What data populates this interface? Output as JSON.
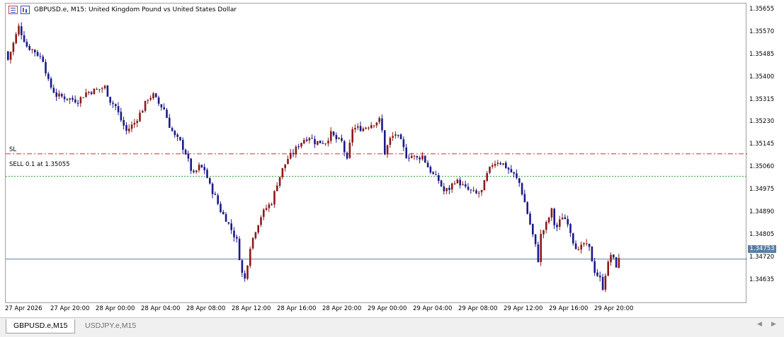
{
  "window": {
    "title": "GBPUSD.e, M15:  United Kingdom Pound vs United States Dollar"
  },
  "icons": {
    "title_left": "order-list-icon",
    "title_right": "candle-chart-icon"
  },
  "price_axis": {
    "labels": [
      "1.35655",
      "1.35570",
      "1.35485",
      "1.35400",
      "1.35315",
      "1.35230",
      "1.35145",
      "1.35060",
      "1.34975",
      "1.34890",
      "1.34805",
      "1.34720",
      "1.34635"
    ],
    "current_price": "1.34753"
  },
  "time_axis": {
    "labels": [
      "27 Apr 2026",
      "27 Apr 20:00",
      "28 Apr 00:00",
      "28 Apr 04:00",
      "28 Apr 08:00",
      "28 Apr 12:00",
      "28 Apr 16:00",
      "28 Apr 20:00",
      "29 Apr 00:00",
      "29 Apr 04:00",
      "29 Apr 08:00",
      "29 Apr 12:00",
      "29 Apr 16:00",
      "29 Apr 20:00"
    ]
  },
  "trade_lines": {
    "sl_label": "SL",
    "sell_label": "SELL 0.1 at 1.35055",
    "sl_price": 1.35137,
    "sell_price": 1.35055,
    "sl_color": "#d03030",
    "sell_color": "#3aa03a",
    "bid_color": "#5c7fa0"
  },
  "colors": {
    "bull": "#8b1a1a",
    "bear": "#1a1a8b",
    "background": "#ffffff"
  },
  "tabs": [
    {
      "label": "GBPUSD.e,M15",
      "active": true
    },
    {
      "label": "USDJPY.e,M15",
      "active": false
    }
  ],
  "chart_data": {
    "type": "candlestick",
    "symbol": "GBPUSD.e",
    "timeframe": "M15",
    "ylim": [
      1.3459,
      1.35685
    ],
    "close_path": [
      [
        0,
        1.3548
      ],
      [
        4,
        1.356
      ],
      [
        7,
        1.3553
      ],
      [
        10,
        1.3551
      ],
      [
        13,
        1.3548
      ],
      [
        15,
        1.354
      ],
      [
        16,
        1.3538
      ],
      [
        18,
        1.3535
      ],
      [
        22,
        1.3534
      ],
      [
        26,
        1.3533
      ],
      [
        29,
        1.3536
      ],
      [
        33,
        1.3537
      ],
      [
        36,
        1.3538
      ],
      [
        38,
        1.3533
      ],
      [
        40,
        1.3531
      ],
      [
        42,
        1.3526
      ],
      [
        44,
        1.3522
      ],
      [
        47,
        1.3525
      ],
      [
        50,
        1.353
      ],
      [
        52,
        1.3534
      ],
      [
        54,
        1.3535
      ],
      [
        56,
        1.3532
      ],
      [
        58,
        1.353
      ],
      [
        60,
        1.3524
      ],
      [
        62,
        1.352
      ],
      [
        64,
        1.3518
      ],
      [
        66,
        1.3514
      ],
      [
        68,
        1.3508
      ],
      [
        69,
        1.3506
      ],
      [
        71,
        1.3509
      ],
      [
        73,
        1.3508
      ],
      [
        75,
        1.3502
      ],
      [
        77,
        1.3498
      ],
      [
        79,
        1.3493
      ],
      [
        81,
        1.349
      ],
      [
        83,
        1.3486
      ],
      [
        85,
        1.3482
      ],
      [
        86,
        1.3476
      ],
      [
        87,
        1.347
      ],
      [
        88,
        1.3468
      ],
      [
        89,
        1.3474
      ],
      [
        90,
        1.348
      ],
      [
        92,
        1.3486
      ],
      [
        94,
        1.3491
      ],
      [
        96,
        1.3494
      ],
      [
        98,
        1.3496
      ],
      [
        100,
        1.3503
      ],
      [
        102,
        1.3508
      ],
      [
        104,
        1.3512
      ],
      [
        106,
        1.3514
      ],
      [
        108,
        1.3517
      ],
      [
        110,
        1.3519
      ],
      [
        112,
        1.352
      ],
      [
        114,
        1.3518
      ],
      [
        116,
        1.3518
      ],
      [
        118,
        1.3518
      ],
      [
        120,
        1.3521
      ],
      [
        122,
        1.3519
      ],
      [
        124,
        1.3518
      ],
      [
        126,
        1.3511
      ],
      [
        128,
        1.3523
      ],
      [
        132,
        1.3523
      ],
      [
        134,
        1.3524
      ],
      [
        136,
        1.3525
      ],
      [
        138,
        1.3526
      ],
      [
        139,
        1.3522
      ],
      [
        140,
        1.3514
      ],
      [
        142,
        1.3519
      ],
      [
        144,
        1.3521
      ],
      [
        146,
        1.3518
      ],
      [
        148,
        1.3513
      ],
      [
        150,
        1.3513
      ],
      [
        152,
        1.3512
      ],
      [
        154,
        1.3513
      ],
      [
        156,
        1.3509
      ],
      [
        158,
        1.3506
      ],
      [
        160,
        1.3504
      ],
      [
        162,
        1.35
      ],
      [
        164,
        1.3501
      ],
      [
        166,
        1.3504
      ],
      [
        168,
        1.3503
      ],
      [
        170,
        1.3501
      ],
      [
        172,
        1.35
      ],
      [
        174,
        1.3499
      ],
      [
        176,
        1.35
      ],
      [
        178,
        1.3506
      ],
      [
        180,
        1.351
      ],
      [
        182,
        1.3511
      ],
      [
        184,
        1.351
      ],
      [
        186,
        1.3508
      ],
      [
        188,
        1.3506
      ],
      [
        190,
        1.3503
      ],
      [
        192,
        1.3496
      ],
      [
        194,
        1.3488
      ],
      [
        196,
        1.348
      ],
      [
        197,
        1.3475
      ],
      [
        198,
        1.3484
      ],
      [
        200,
        1.3488
      ],
      [
        202,
        1.3493
      ],
      [
        203,
        1.3488
      ],
      [
        204,
        1.3487
      ],
      [
        206,
        1.3491
      ],
      [
        208,
        1.3489
      ],
      [
        210,
        1.3482
      ],
      [
        212,
        1.3478
      ],
      [
        214,
        1.3481
      ],
      [
        216,
        1.3479
      ],
      [
        218,
        1.3471
      ],
      [
        220,
        1.3468
      ],
      [
        221,
        1.3465
      ],
      [
        222,
        1.347
      ],
      [
        224,
        1.3477
      ],
      [
        226,
        1.3473
      ],
      [
        227,
        1.3475
      ]
    ]
  }
}
